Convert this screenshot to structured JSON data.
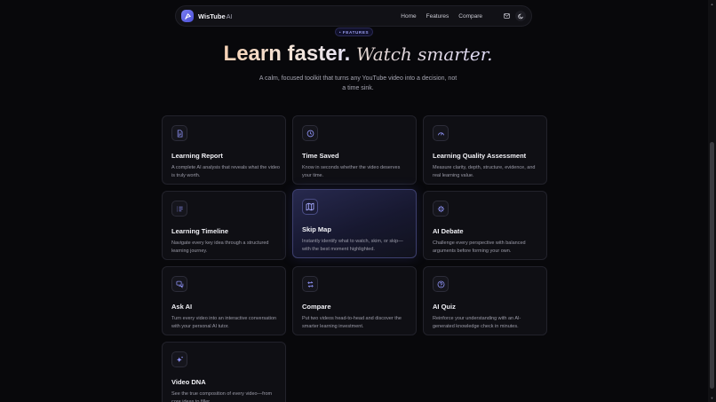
{
  "nav": {
    "brand_name": "WisTube",
    "brand_suffix": "AI",
    "links": [
      "Home",
      "Features",
      "Compare"
    ],
    "icons": [
      "mail-icon",
      "moon-icon"
    ]
  },
  "hero": {
    "pill": "• FEATURES",
    "title_a": "Learn faster.",
    "title_b": "Watch smarter.",
    "subtitle": "A calm, focused toolkit that turns any YouTube video into a decision, not a time sink."
  },
  "features": [
    {
      "title": "Learning Report",
      "desc": "A complete AI analysis that reveals what the video is truly worth.",
      "icon": "document-icon"
    },
    {
      "title": "Time Saved",
      "desc": "Know in seconds whether the video deserves your time.",
      "icon": "clock-icon"
    },
    {
      "title": "Learning Quality Assessment",
      "desc": "Measure clarity, depth, structure, evidence, and real learning value.",
      "icon": "gauge-icon"
    },
    {
      "title": "Learning Timeline",
      "desc": "Navigate every key idea through a structured learning journey.",
      "icon": "list-icon"
    },
    {
      "title": "Skip Map",
      "desc": "Instantly identify what to watch, skim, or skip—with the best moment highlighted.",
      "icon": "map-icon"
    },
    {
      "title": "AI Debate",
      "desc": "Challenge every perspective with balanced arguments before forming your own.",
      "icon": "gear-icon"
    },
    {
      "title": "Ask AI",
      "desc": "Turn every video into an interactive conversation with your personal AI tutor.",
      "icon": "chat-icon"
    },
    {
      "title": "Compare",
      "desc": "Put two videos head-to-head and discover the smarter learning investment.",
      "icon": "compare-icon"
    },
    {
      "title": "AI Quiz",
      "desc": "Reinforce your understanding with an AI-generated knowledge check in minutes.",
      "icon": "question-icon"
    },
    {
      "title": "Video DNA",
      "desc": "See the true composition of every video—from core ideas to filler.",
      "icon": "sparkle-icon"
    }
  ],
  "colors": {
    "accent": "#7a7ff5",
    "background": "#08080b",
    "card": "#0f0f14"
  }
}
